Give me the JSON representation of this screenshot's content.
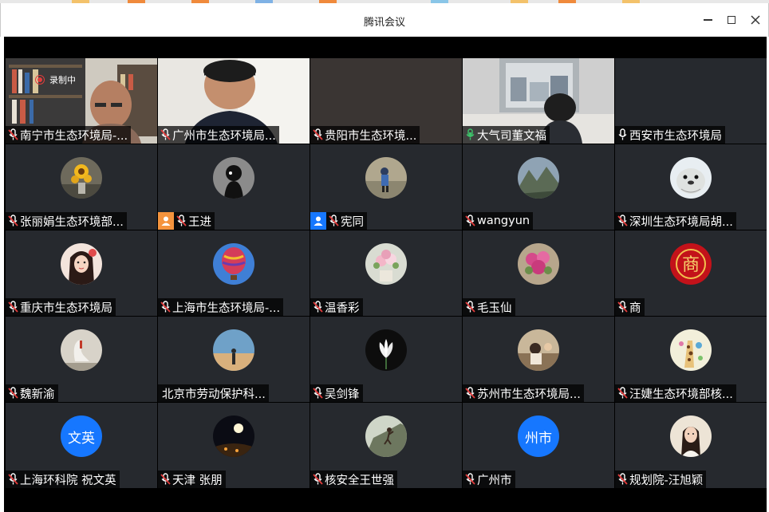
{
  "window": {
    "title": "腾讯会议"
  },
  "recording": {
    "label": "录制中"
  },
  "colors": {
    "accent": "#1677ff",
    "active_speaker": "#3ec26a",
    "recording": "#e23c3c",
    "tile_bg": "#26292e"
  },
  "participants": [
    {
      "name": "南宁市生态环境局-...",
      "mic": "muted",
      "media": "video-bookshelf"
    },
    {
      "name": "广州市生态环境局...",
      "mic": "muted",
      "media": "video-man"
    },
    {
      "name": "贵阳市生态环境...",
      "mic": "muted",
      "media": "video-dark"
    },
    {
      "name": "大气司董文福",
      "mic": "speaking",
      "media": "video-office",
      "active": true
    },
    {
      "name": "西安市生态环境局",
      "mic": "on",
      "media": "blank"
    },
    {
      "name": "张丽娟生态环境部...",
      "mic": "muted",
      "media": "avatar-sunflower"
    },
    {
      "name": "王进",
      "mic": "muted",
      "media": "avatar-silhouette",
      "badge": "orange"
    },
    {
      "name": "宪同",
      "mic": "muted",
      "media": "avatar-child",
      "badge": "blue"
    },
    {
      "name": "wangyun",
      "mic": "muted",
      "media": "avatar-mountain"
    },
    {
      "name": "深圳生态环境局胡...",
      "mic": "muted",
      "media": "avatar-seal"
    },
    {
      "name": "重庆市生态环境局",
      "mic": "muted",
      "media": "avatar-woman"
    },
    {
      "name": "上海市生态环境局-...",
      "mic": "muted",
      "media": "avatar-balloon"
    },
    {
      "name": "温香彩",
      "mic": "muted",
      "media": "avatar-flowers"
    },
    {
      "name": "毛玉仙",
      "mic": "muted",
      "media": "avatar-pink-flowers"
    },
    {
      "name": "商",
      "mic": "muted",
      "media": "avatar-shang"
    },
    {
      "name": "魏新渝",
      "mic": "muted",
      "media": "avatar-swan"
    },
    {
      "name": "北京市劳动保护科...",
      "mic": "none",
      "media": "avatar-desert"
    },
    {
      "name": "吴剑锋",
      "mic": "muted",
      "media": "avatar-lotus"
    },
    {
      "name": "苏州市生态环境局...",
      "mic": "muted",
      "media": "avatar-photo"
    },
    {
      "name": "汪婕生态环境部核...",
      "mic": "muted",
      "media": "avatar-giraffe"
    },
    {
      "name": "上海环科院 祝文英",
      "mic": "muted",
      "media": "avatar-text",
      "avatar_text": "文英"
    },
    {
      "name": "天津 张朋",
      "mic": "muted",
      "media": "avatar-moon"
    },
    {
      "name": "核安全王世强",
      "mic": "muted",
      "media": "avatar-climber"
    },
    {
      "name": "广州市",
      "mic": "muted",
      "media": "avatar-text",
      "avatar_text": "州市"
    },
    {
      "name": "规划院-汪旭颖",
      "mic": "muted",
      "media": "avatar-girl"
    }
  ]
}
